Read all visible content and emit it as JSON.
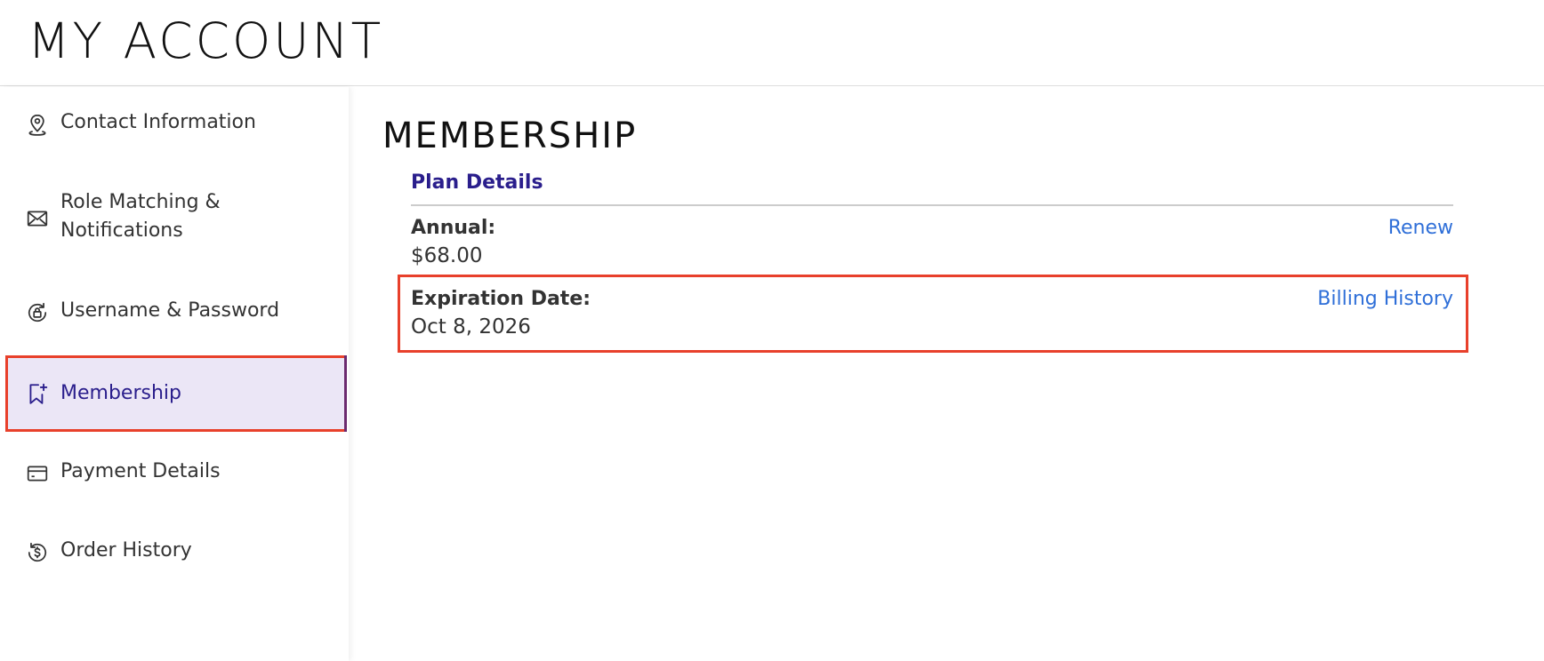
{
  "header": {
    "title": "MY ACCOUNT"
  },
  "sidebar": {
    "items": [
      {
        "label": "Contact Information",
        "icon": "location-pin-icon"
      },
      {
        "label": "Role Matching &\nNotifications",
        "icon": "envelope-icon"
      },
      {
        "label": "Username & Password",
        "icon": "lock-refresh-icon"
      },
      {
        "label": "Membership",
        "icon": "bookmark-plus-icon",
        "active": true
      },
      {
        "label": "Payment Details",
        "icon": "credit-card-icon"
      },
      {
        "label": "Order History",
        "icon": "dollar-history-icon"
      }
    ]
  },
  "main": {
    "title": "MEMBERSHIP",
    "plan_heading": "Plan Details",
    "annual": {
      "label": "Annual:",
      "value": "$68.00",
      "action": "Renew"
    },
    "expiration": {
      "label": "Expiration Date:",
      "value": "Oct 8, 2026",
      "action": "Billing History"
    }
  },
  "colors": {
    "accent": "#2a1e8c",
    "link": "#2f6fd8",
    "highlight": "#e8402b",
    "active_bg": "#ebe6f6"
  }
}
